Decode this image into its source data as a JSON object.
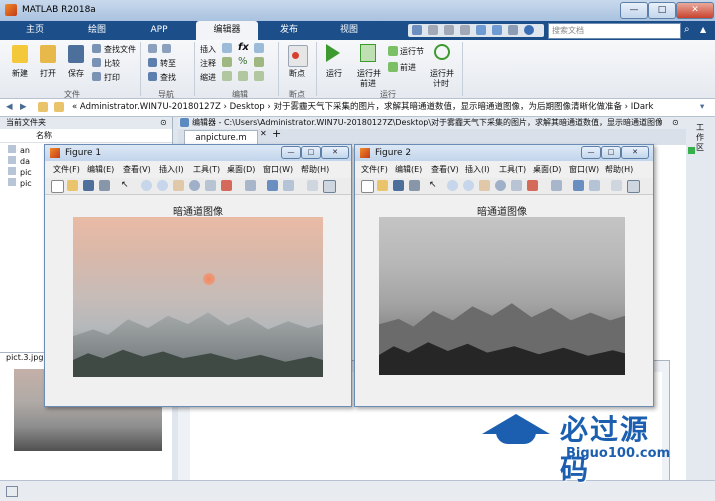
{
  "app": {
    "title": "MATLAB R2018a"
  },
  "tabs": [
    {
      "label": "主页"
    },
    {
      "label": "绘图"
    },
    {
      "label": "APP"
    },
    {
      "label": "编辑器"
    },
    {
      "label": "发布"
    },
    {
      "label": "视图"
    }
  ],
  "search": {
    "placeholder": "搜索文档"
  },
  "ribbon": {
    "new": "新建",
    "open": "打开",
    "save": "保存",
    "find_files": "查找文件",
    "compare": "比较",
    "print": "打印",
    "goto": "转至",
    "find": "查找",
    "insert": "插入",
    "comment": "注释",
    "indent": "缩进",
    "breakpoints": "断点",
    "run": "运行",
    "run_advance": [
      "运行并",
      "前进"
    ],
    "run_section": "运行节",
    "advance": "前进",
    "run_time": [
      "运行并",
      "计时"
    ],
    "sections": [
      "文件",
      "导航",
      "编辑",
      "断点",
      "运行"
    ]
  },
  "address": {
    "path": "« Administrator.WIN7U-20180127Z › Desktop › 对于雾霾天气下采集的图片，求解其暗通道数值，显示暗通道图像，为后期图像清晰化做准备 › IDark"
  },
  "left_panel": {
    "title": "当前文件夹",
    "column": "名称",
    "files": [
      "an",
      "da",
      "pic",
      "pic"
    ],
    "preview_label": "pict.3.jpg"
  },
  "editor": {
    "header": "编辑器 - C:\\Users\\Administrator.WIN7U-20180127Z\\Desktop\\对于雾霾天气下采集的图片，求解其暗通道数值，显示暗通道图像",
    "tab": "anpicture.m"
  },
  "right_bar": {
    "label": "工作区"
  },
  "figures": [
    {
      "title": "Figure 1",
      "menu": [
        "文件(F)",
        "编辑(E)",
        "查看(V)",
        "插入(I)",
        "工具(T)",
        "桌面(D)",
        "窗口(W)",
        "帮助(H)"
      ],
      "image_title": "暗通道图像"
    },
    {
      "title": "Figure 2",
      "menu": [
        "文件(F)",
        "编辑(E)",
        "查看(V)",
        "插入(I)",
        "工具(T)",
        "桌面(D)",
        "窗口(W)",
        "帮助(H)"
      ],
      "image_title": "暗通道图像"
    }
  ],
  "watermark": {
    "name": "必过源码",
    "url": "Biguo100.com"
  },
  "colors": {
    "tabbar": "#1c4f8a",
    "accent": "#1f5fa8",
    "watermark": "#1c5fb0"
  }
}
